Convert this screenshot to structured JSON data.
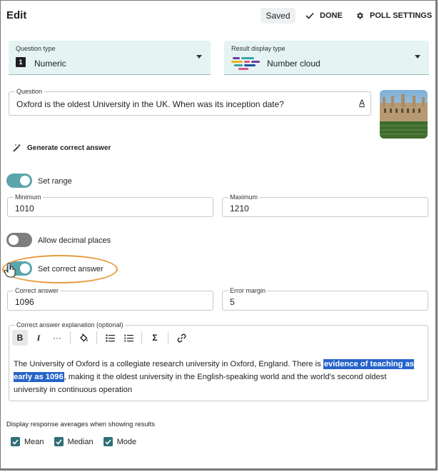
{
  "header": {
    "title": "Edit",
    "saved": "Saved",
    "done": "DONE",
    "poll_settings": "POLL SETTINGS"
  },
  "question_type": {
    "label": "Question type",
    "icon_text": "1",
    "value": "Numeric"
  },
  "result_display": {
    "label": "Result display type",
    "value": "Number cloud"
  },
  "question": {
    "label": "Question",
    "value": "Oxford is the oldest University in the UK. When was its inception date?",
    "format_icon": "A"
  },
  "generate": {
    "label": "Generate correct answer"
  },
  "set_range": {
    "label": "Set range",
    "on": true
  },
  "minimum": {
    "label": "Minimum",
    "value": "1010"
  },
  "maximum": {
    "label": "Maximum",
    "value": "1210"
  },
  "decimal": {
    "label": "Allow decimal places",
    "on": false
  },
  "correct_toggle": {
    "label": "Set correct answer",
    "on": true
  },
  "correct_answer": {
    "label": "Correct answer",
    "value": "1096"
  },
  "error_margin": {
    "label": "Error margin",
    "value": "5"
  },
  "explanation": {
    "label": "Correct answer explanation (optional)",
    "toolbar": {
      "bold": "B",
      "italic": "I",
      "more": "···",
      "formula": "Σ"
    },
    "text_before": "The University of Oxford is a collegiate research university in Oxford, England. There is ",
    "text_highlight": "evidence of teaching as early as 1096",
    "text_after": ", making it the oldest university in the English-speaking world and the world's second oldest university in continuous operation"
  },
  "averages": {
    "title": "Display response averages when showing results",
    "options": [
      {
        "label": "Mean",
        "checked": true
      },
      {
        "label": "Median",
        "checked": true
      },
      {
        "label": "Mode",
        "checked": true
      }
    ]
  },
  "colors": {
    "accent": "#5aa5ab",
    "select_bg": "#e5f3f3",
    "highlight": "#2563c9",
    "ring": "#e89a3c",
    "checkbox": "#2e6f78"
  }
}
